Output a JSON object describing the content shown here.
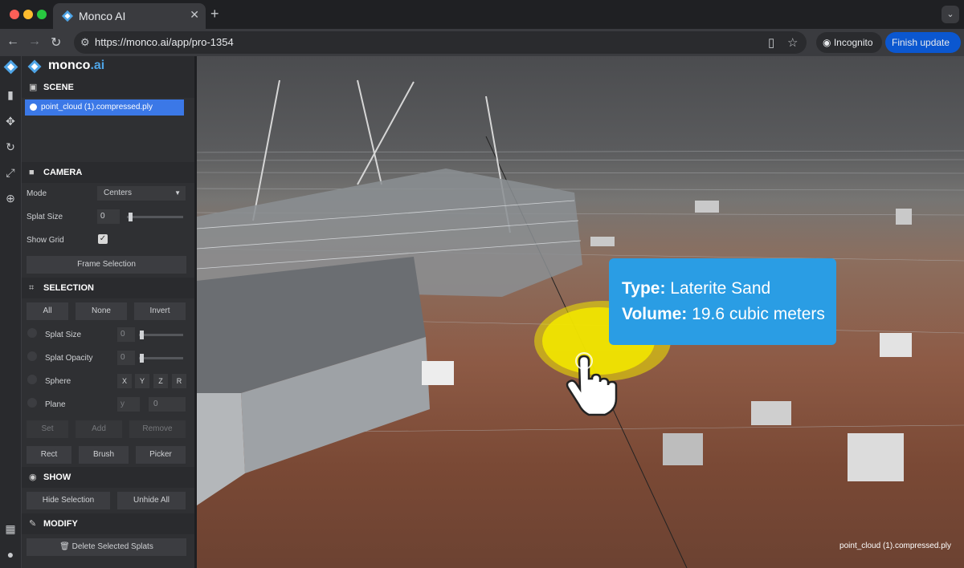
{
  "browser": {
    "tab_title": "Monco AI",
    "tab_close": "✕",
    "new_tab": "+",
    "tab_menu": "⌄",
    "url": "https://monco.ai/app/pro-1354",
    "incognito_label": "Incognito",
    "update_label": "Finish update"
  },
  "logo": {
    "main": "monco",
    "dot_ai": ".ai"
  },
  "scene": {
    "header": "SCENE",
    "items": [
      "point_cloud (1).compressed.ply"
    ]
  },
  "camera": {
    "header": "CAMERA",
    "mode_label": "Mode",
    "mode_value": "Centers",
    "splat_size_label": "Splat Size",
    "splat_size_value": "0",
    "show_grid_label": "Show Grid",
    "show_grid_checked": true,
    "frame_selection": "Frame Selection"
  },
  "selection": {
    "header": "SELECTION",
    "all": "All",
    "none": "None",
    "invert": "Invert",
    "splat_size_label": "Splat Size",
    "splat_size_value": "0",
    "splat_opacity_label": "Splat Opacity",
    "splat_opacity_value": "0",
    "sphere_label": "Sphere",
    "axes": [
      "X",
      "Y",
      "Z",
      "R"
    ],
    "plane_label": "Plane",
    "plane_axis": "y",
    "plane_value": "0",
    "set": "Set",
    "add": "Add",
    "remove": "Remove",
    "rect": "Rect",
    "brush": "Brush",
    "picker": "Picker"
  },
  "show": {
    "header": "SHOW",
    "hide_selection": "Hide Selection",
    "unhide_all": "Unhide All"
  },
  "modify": {
    "header": "MODIFY",
    "delete_selected": "Delete Selected Splats"
  },
  "tooltip": {
    "type_label": "Type:",
    "type_value": "Laterite Sand",
    "volume_label": "Volume:",
    "volume_value": "19.6 cubic meters"
  },
  "viewport": {
    "file_label": "point_cloud (1).compressed.ply"
  },
  "colors": {
    "accent": "#2a9de4",
    "highlight": "#f2e600",
    "selected_item": "#3b78e7"
  }
}
